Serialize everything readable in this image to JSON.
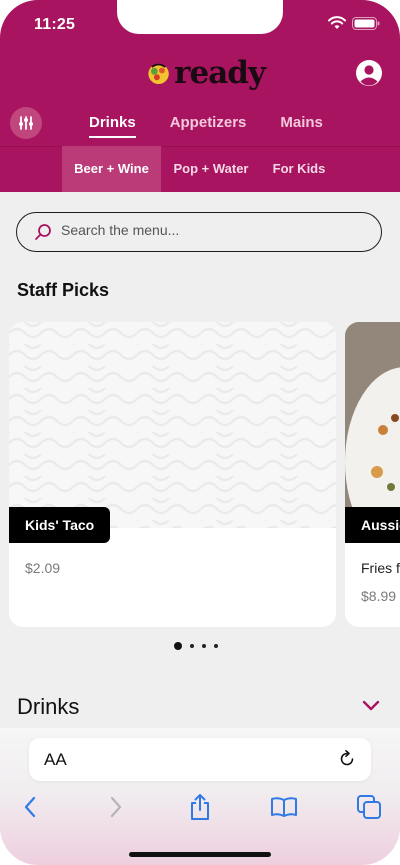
{
  "status_bar": {
    "time": "11:25"
  },
  "brand": {
    "name": "ready"
  },
  "categories": {
    "tabs": [
      {
        "label": "Drinks",
        "active": true
      },
      {
        "label": "Appetizers",
        "active": false
      },
      {
        "label": "Mains",
        "active": false
      }
    ],
    "subtabs": [
      {
        "label": "Beer + Wine",
        "active": true
      },
      {
        "label": "Pop + Water",
        "active": false
      },
      {
        "label": "For Kids",
        "active": false
      }
    ]
  },
  "search": {
    "placeholder": "Search the menu..."
  },
  "staff_picks": {
    "title": "Staff Picks",
    "cards": [
      {
        "name": "Kids' Taco",
        "price": "$2.09"
      },
      {
        "name": "Aussie",
        "description": "Fries f",
        "price": "$8.99"
      }
    ],
    "carousel_pages": 4,
    "active_page": 1
  },
  "section": {
    "title": "Drinks"
  },
  "browser": {
    "text_size_label": "AA",
    "icons": [
      "back-icon",
      "forward-icon",
      "share-icon",
      "bookmarks-icon",
      "tabs-icon",
      "reload-icon"
    ]
  },
  "colors": {
    "brand": "#a8145f",
    "accent": "#bb3b78"
  }
}
